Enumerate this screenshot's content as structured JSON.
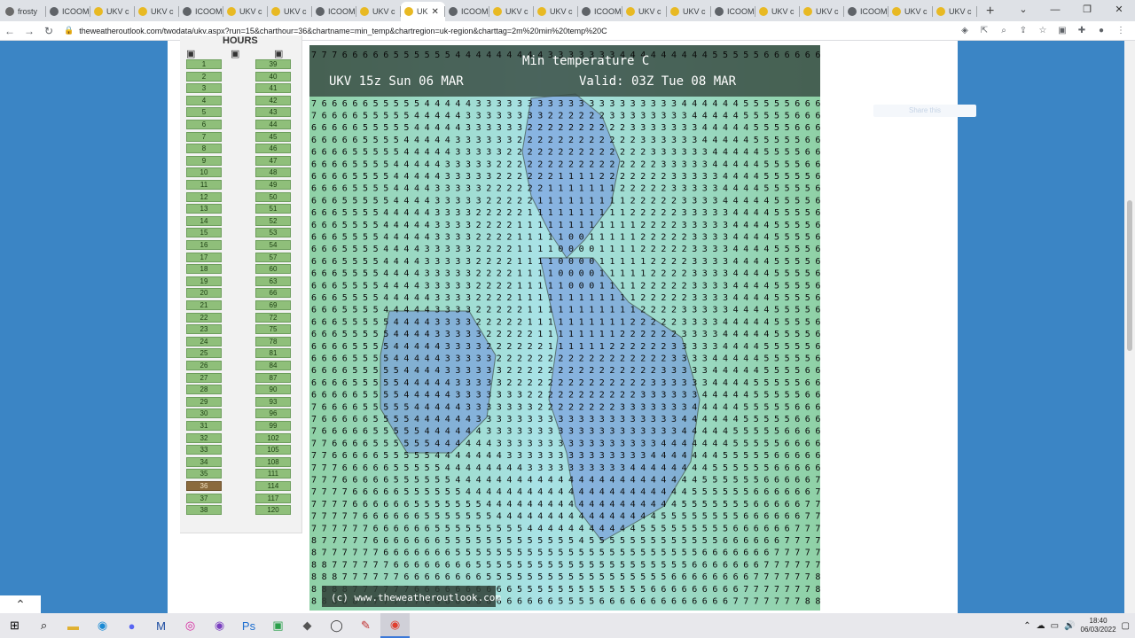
{
  "browser": {
    "tabs": [
      {
        "label": "frosty",
        "color": "#6b6b6b"
      },
      {
        "label": "ICOOM",
        "color": "#5f6368"
      },
      {
        "label": "UKV c",
        "color": "#e8b923"
      },
      {
        "label": "UKV c",
        "color": "#e8b923"
      },
      {
        "label": "ICOOM",
        "color": "#5f6368"
      },
      {
        "label": "UKV c",
        "color": "#e8b923"
      },
      {
        "label": "UKV c",
        "color": "#e8b923"
      },
      {
        "label": "ICOOM",
        "color": "#5f6368"
      },
      {
        "label": "UKV c",
        "color": "#e8b923"
      },
      {
        "label": "UK",
        "color": "#e8b923",
        "active": true
      },
      {
        "label": "ICOOM",
        "color": "#5f6368"
      },
      {
        "label": "UKV c",
        "color": "#e8b923"
      },
      {
        "label": "UKV c",
        "color": "#e8b923"
      },
      {
        "label": "ICOOM",
        "color": "#5f6368"
      },
      {
        "label": "UKV c",
        "color": "#e8b923"
      },
      {
        "label": "UKV c",
        "color": "#e8b923"
      },
      {
        "label": "ICOOM",
        "color": "#5f6368"
      },
      {
        "label": "UKV c",
        "color": "#e8b923"
      },
      {
        "label": "UKV c",
        "color": "#e8b923"
      },
      {
        "label": "ICOOM",
        "color": "#5f6368"
      },
      {
        "label": "UKV c",
        "color": "#e8b923"
      },
      {
        "label": "UKV c",
        "color": "#e8b923"
      }
    ],
    "url_host": "theweatheroutlook.com",
    "url_path": "/twodata/ukv.aspx?run=15&charthour=36&chartname=min_temp&chartregion=uk-region&charttag=2m%20min%20temp%20C"
  },
  "hours_panel": {
    "title": "HOURS",
    "col1": [
      "1",
      "2",
      "3",
      "4",
      "5",
      "6",
      "7",
      "8",
      "9",
      "10",
      "11",
      "12",
      "13",
      "14",
      "15",
      "16",
      "17",
      "18",
      "19",
      "20",
      "21",
      "22",
      "23",
      "24",
      "25",
      "26",
      "27",
      "28",
      "29",
      "30",
      "31",
      "32",
      "33",
      "34",
      "35",
      "36",
      "37",
      "38"
    ],
    "col2": [
      "39",
      "40",
      "41",
      "42",
      "43",
      "44",
      "45",
      "46",
      "47",
      "48",
      "49",
      "50",
      "51",
      "52",
      "53",
      "54",
      "57",
      "60",
      "63",
      "66",
      "69",
      "72",
      "75",
      "78",
      "81",
      "84",
      "87",
      "90",
      "93",
      "96",
      "99",
      "102",
      "105",
      "108",
      "111",
      "114",
      "117",
      "120"
    ],
    "selected": "36"
  },
  "chart": {
    "title": "Min temperature  C",
    "run_label": "UKV 15z Sun 06 MAR",
    "valid_label": "Valid: 03Z Tue 08 MAR",
    "copyright": "(c) www.theweatheroutlook.com",
    "colors": {
      "header": "#3a4d44",
      "sea_warm": "#8fd1a6",
      "sea_cool": "#a8e2e6",
      "cold": "#6f8fe0"
    }
  },
  "right_link": "Share this",
  "taskbar": {
    "time": "18:40",
    "date": "06/03/2022"
  }
}
